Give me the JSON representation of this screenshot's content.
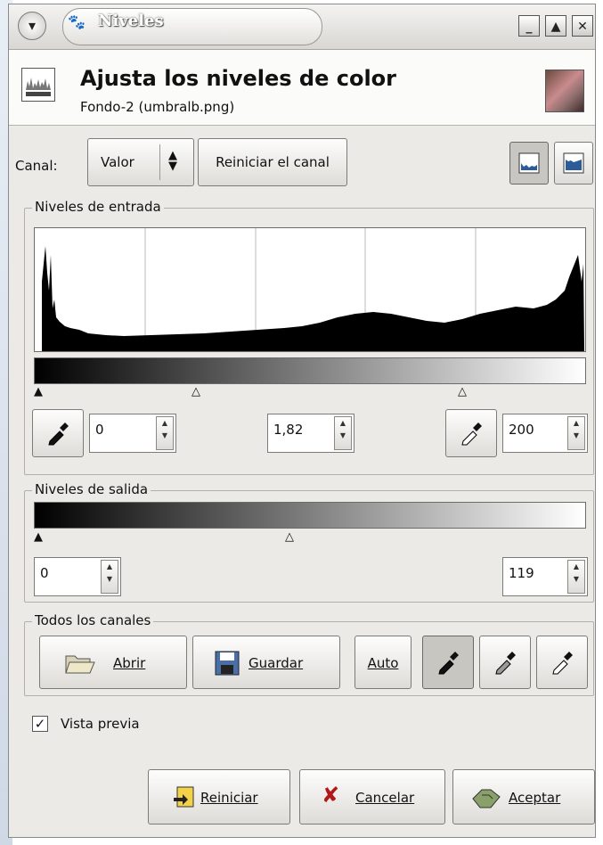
{
  "window": {
    "title": "Niveles",
    "buttons": [
      "minimize",
      "maximize",
      "close"
    ]
  },
  "header": {
    "title": "Ajusta los niveles de color",
    "subtitle": "Fondo-2 (umbralb.png)"
  },
  "channel": {
    "label": "Canal:",
    "selected": "Valor",
    "reset_label": "Reiniciar el canal"
  },
  "input_levels": {
    "frame_label": "Niveles de entrada",
    "low": "0",
    "gamma": "1,82",
    "high": "200"
  },
  "output_levels": {
    "frame_label": "Niveles de salida",
    "low": "0",
    "high": "119"
  },
  "all_channels": {
    "frame_label": "Todos los canales",
    "open_label": "Abrir",
    "save_label": "Guardar",
    "auto_label": "Auto"
  },
  "preview": {
    "label": "Vista previa",
    "checked": true
  },
  "footer": {
    "reset_label": "Reiniciar",
    "cancel_label": "Cancelar",
    "accept_label": "Aceptar"
  }
}
